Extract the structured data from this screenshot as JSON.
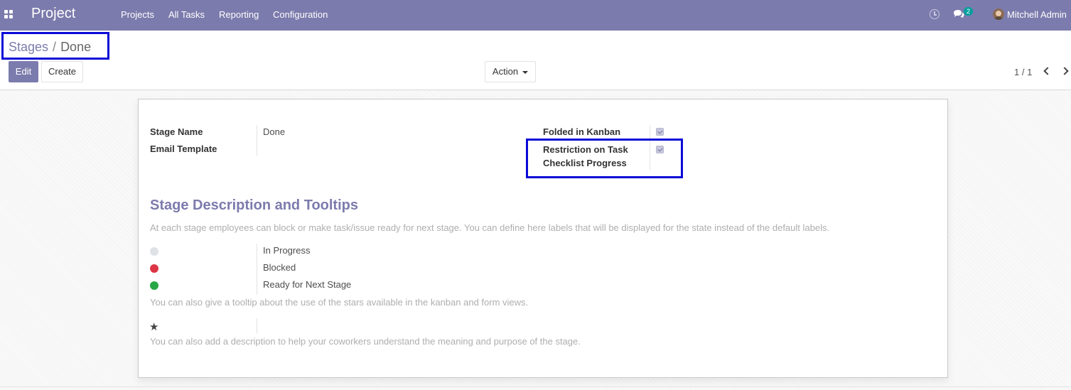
{
  "navbar": {
    "app_name": "Project",
    "menu": [
      "Projects",
      "All Tasks",
      "Reporting",
      "Configuration"
    ],
    "chat_badge": "2",
    "user_name": "Mitchell Admin",
    "background": "#7c7bad"
  },
  "breadcrumb": {
    "parent": "Stages",
    "separator": "/",
    "current": "Done"
  },
  "buttons": {
    "edit": "Edit",
    "create": "Create",
    "action": "Action"
  },
  "pager": {
    "value": "1 / 1"
  },
  "form": {
    "stage_name_label": "Stage Name",
    "stage_name_value": "Done",
    "email_template_label": "Email Template",
    "email_template_value": "",
    "folded_label": "Folded in Kanban",
    "folded_checked": true,
    "restriction_label_line1": "Restriction on Task",
    "restriction_label_line2": "Checklist Progress",
    "restriction_checked": true
  },
  "section": {
    "title": "Stage Description and Tooltips",
    "help_text": "At each stage employees can block or make task/issue ready for next stage. You can define here labels that will be displayed for the state instead of the default labels.",
    "states": [
      {
        "color": "#dee2e6",
        "label": "In Progress"
      },
      {
        "color": "#dc3545",
        "label": "Blocked"
      },
      {
        "color": "#28a745",
        "label": "Ready for Next Stage"
      }
    ],
    "star_help": "You can also give a tooltip about the use of the stars available in the kanban and form views.",
    "description_help": "You can also add a description to help your coworkers understand the meaning and purpose of the stage."
  }
}
